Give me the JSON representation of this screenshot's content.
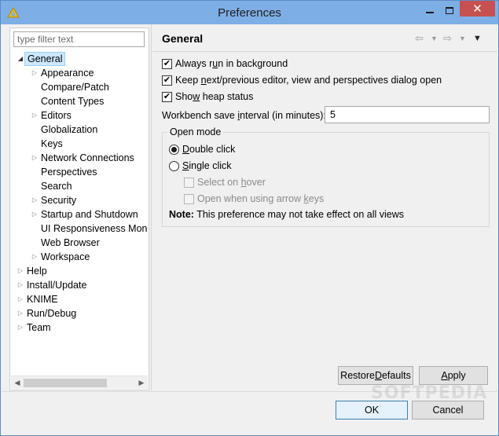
{
  "window": {
    "title": "Preferences",
    "minimize_glyph": "",
    "close_glyph": "✕"
  },
  "filter": {
    "placeholder": "type filter text",
    "value": ""
  },
  "tree": {
    "items": [
      {
        "label": "General",
        "expanded": true,
        "selected": true
      },
      {
        "label": "Appearance",
        "has_children": true
      },
      {
        "label": "Compare/Patch"
      },
      {
        "label": "Content Types"
      },
      {
        "label": "Editors",
        "has_children": true
      },
      {
        "label": "Globalization"
      },
      {
        "label": "Keys"
      },
      {
        "label": "Network Connections",
        "has_children": true
      },
      {
        "label": "Perspectives"
      },
      {
        "label": "Search"
      },
      {
        "label": "Security",
        "has_children": true
      },
      {
        "label": "Startup and Shutdown",
        "has_children": true
      },
      {
        "label": "UI Responsiveness Mon"
      },
      {
        "label": "Web Browser"
      },
      {
        "label": "Workspace",
        "has_children": true
      },
      {
        "label": "Help",
        "has_children": true
      },
      {
        "label": "Install/Update",
        "has_children": true
      },
      {
        "label": "KNIME",
        "has_children": true
      },
      {
        "label": "Run/Debug",
        "has_children": true
      },
      {
        "label": "Team",
        "has_children": true
      }
    ]
  },
  "page": {
    "title": "General",
    "nav": {
      "back": "⇦",
      "forward": "⇨",
      "dropdown": "▼",
      "menu": "▼"
    },
    "options": {
      "always_run_background": {
        "label_pre": "Always r",
        "mnemonic": "u",
        "label_post": "n in background",
        "checked": true
      },
      "keep_next_prev": {
        "label_pre": "Keep ",
        "mnemonic": "n",
        "label_post": "ext/previous editor, view and perspectives dialog open",
        "checked": true
      },
      "show_heap": {
        "label_pre": "Sho",
        "mnemonic": "w",
        "label_post": " heap status",
        "checked": true
      }
    },
    "interval": {
      "label_pre": "Workbench save ",
      "mnemonic": "i",
      "label_post": "nterval (in minutes):",
      "value": "5"
    },
    "open_mode": {
      "title": "Open mode",
      "double_click": {
        "mnemonic": "D",
        "label_post": "ouble click",
        "selected": true
      },
      "single_click": {
        "mnemonic": "S",
        "label_post": "ingle click",
        "selected": false
      },
      "select_on_hover": {
        "label_pre": "Select on ",
        "mnemonic": "h",
        "label_post": "over",
        "enabled": false
      },
      "open_arrow_keys": {
        "label_pre": "Open when using arrow ",
        "mnemonic": "k",
        "label_post": "eys",
        "enabled": false
      }
    },
    "note": {
      "bold": "Note:",
      "text": " This preference may not take effect on all views"
    },
    "restore_defaults": {
      "label_pre": "Restore ",
      "mnemonic": "D",
      "label_post": "efaults"
    },
    "apply": {
      "label_pre": "",
      "mnemonic": "A",
      "label_post": "pply"
    }
  },
  "footer": {
    "ok": "OK",
    "cancel": "Cancel"
  },
  "watermark": "SOFTPEDIA"
}
